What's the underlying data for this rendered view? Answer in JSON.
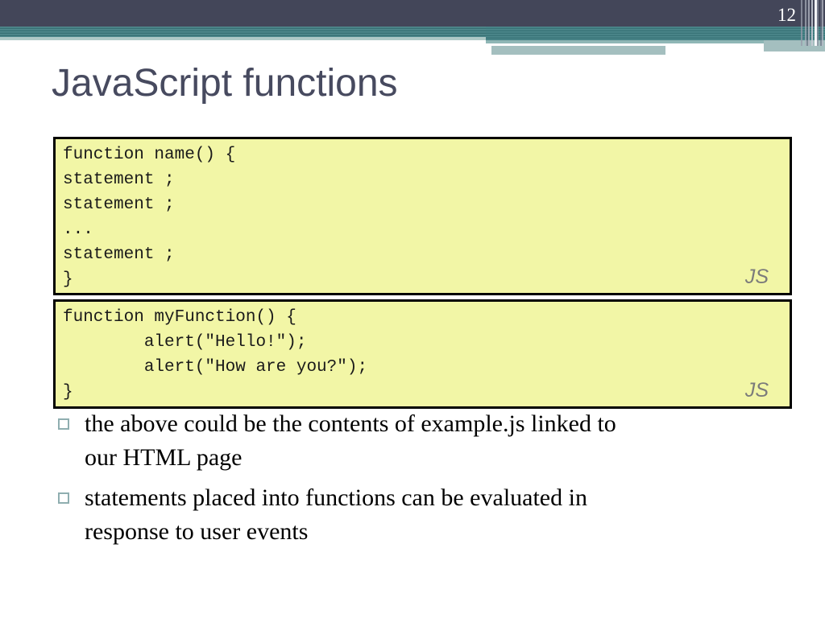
{
  "page_number": "12",
  "title": "JavaScript functions",
  "code_boxes": [
    {
      "lines": [
        "function name() {",
        "statement ;",
        "statement ;",
        "...",
        "statement ;",
        "}"
      ],
      "badge": "JS"
    },
    {
      "lines": [
        "function myFunction() {",
        "        alert(\"Hello!\");",
        "        alert(\"How are you?\");",
        "}"
      ],
      "badge": "JS"
    }
  ],
  "bullets": [
    {
      "lines": [
        "the above could be the contents of example.js linked to",
        "our HTML page"
      ]
    },
    {
      "lines": [
        "statements placed into functions can be evaluated in",
        "response to user events"
      ]
    }
  ],
  "theme": {
    "header_navy": "#434659",
    "header_teal": "#3E7E82",
    "header_light_teal": "#AFC9C7",
    "header_medium_teal": "#8FB6B5",
    "header_band": "#A4BFBF",
    "title_color": "#474A5F",
    "code_background": "#F2F6A6",
    "code_border": "#000000",
    "badge_color": "#7b7b7b",
    "bullet_square_border": "#8FAEB0",
    "page_number_color": "#ffffff"
  }
}
